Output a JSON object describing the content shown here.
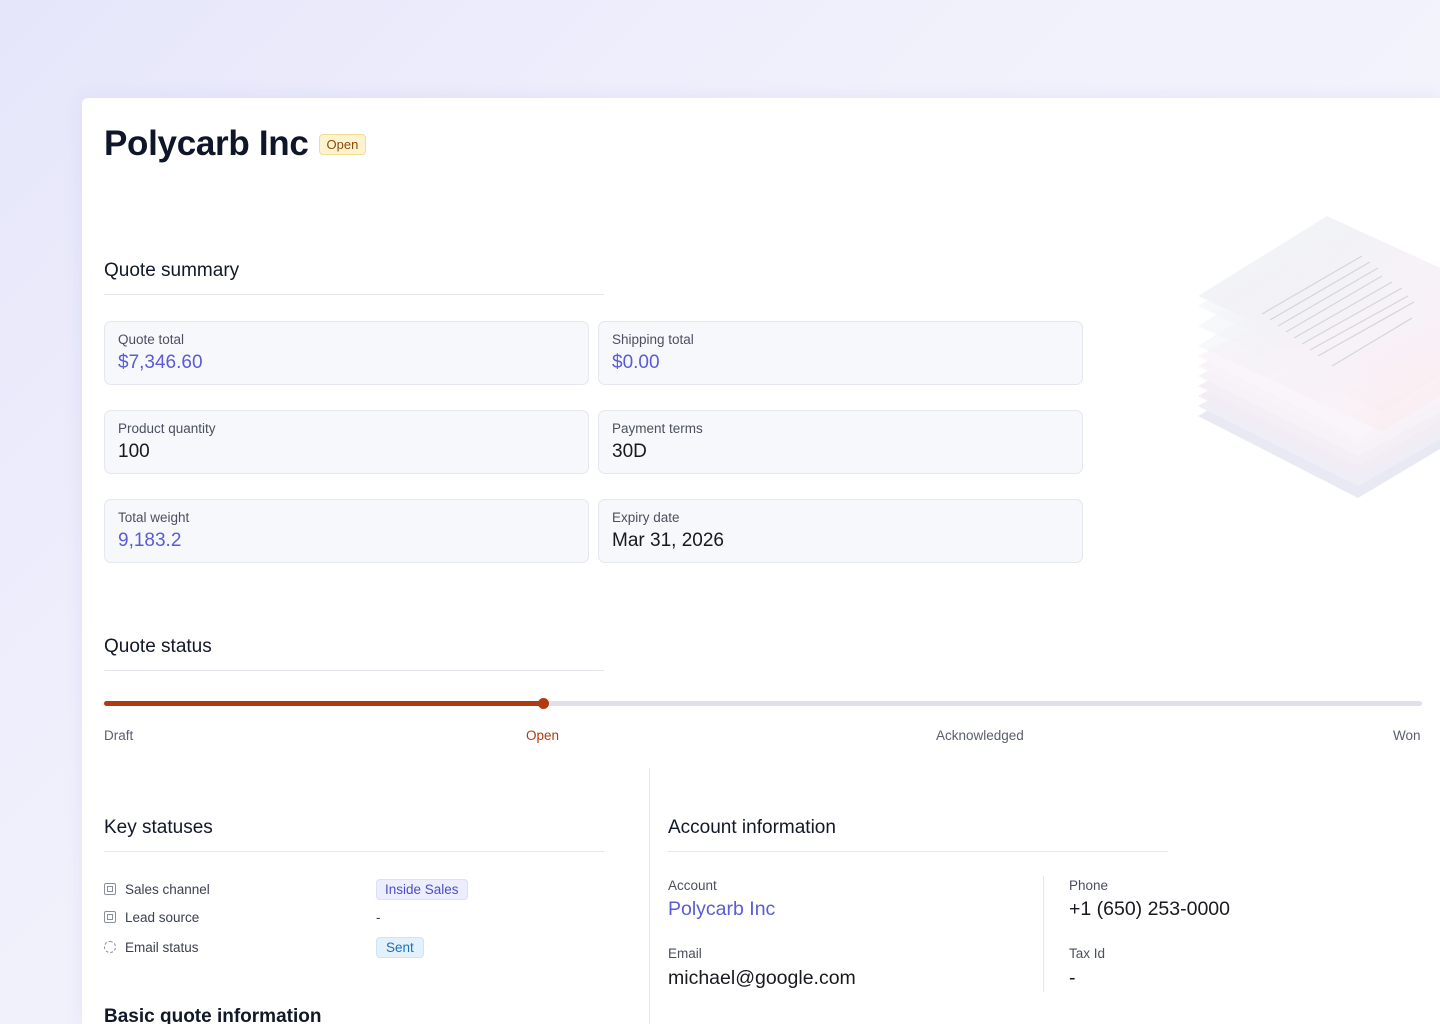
{
  "header": {
    "title": "Polycarb Inc",
    "status_badge": "Open"
  },
  "quote_summary": {
    "heading": "Quote summary",
    "items": [
      {
        "label": "Quote total",
        "value": "$7,346.60"
      },
      {
        "label": "Shipping total",
        "value": "$0.00"
      },
      {
        "label": "Product quantity",
        "value": "100"
      },
      {
        "label": "Payment terms",
        "value": "30D"
      },
      {
        "label": "Total weight",
        "value": "9,183.2"
      },
      {
        "label": "Expiry date",
        "value": "Mar 31, 2026"
      }
    ]
  },
  "quote_status": {
    "heading": "Quote status",
    "stages": [
      "Draft",
      "Open",
      "Acknowledged",
      "Won"
    ],
    "current_stage": "Open",
    "progress_fraction": 0.333
  },
  "key_statuses": {
    "heading": "Key statuses",
    "rows": [
      {
        "label": "Sales channel",
        "value": "Inside Sales"
      },
      {
        "label": "Lead source",
        "value": "-"
      },
      {
        "label": "Email status",
        "value": "Sent"
      }
    ]
  },
  "account_information": {
    "heading": "Account information",
    "account_label": "Account",
    "account_value": "Polycarb Inc",
    "phone_label": "Phone",
    "phone_value": "+1 (650) 253-0000",
    "email_label": "Email",
    "email_value": "michael@google.com",
    "tax_label": "Tax Id",
    "tax_value": "-"
  },
  "basic_quote_information": {
    "heading": "Basic quote information"
  },
  "colors": {
    "accent": "#5b5bd6",
    "progress": "#b03a12",
    "open_badge_bg": "#fdf3cf"
  },
  "icons": [
    "grid-field-icon",
    "dashed-circle-icon",
    "document-stack-illustration"
  ]
}
